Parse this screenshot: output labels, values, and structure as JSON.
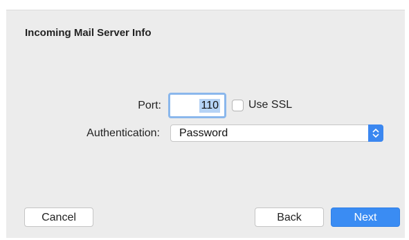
{
  "top_fragment": "·   ·   ·",
  "dialog": {
    "title": "Incoming Mail Server Info",
    "port_label": "Port:",
    "port_value": "110",
    "use_ssl_label": "Use SSL",
    "use_ssl_checked": false,
    "authentication_label": "Authentication:",
    "authentication_value": "Password"
  },
  "buttons": {
    "cancel": "Cancel",
    "back": "Back",
    "next": "Next"
  },
  "colors": {
    "accent": "#3a8cf3",
    "panel_bg": "#ececec",
    "focus_ring": "#8ab7ec"
  }
}
